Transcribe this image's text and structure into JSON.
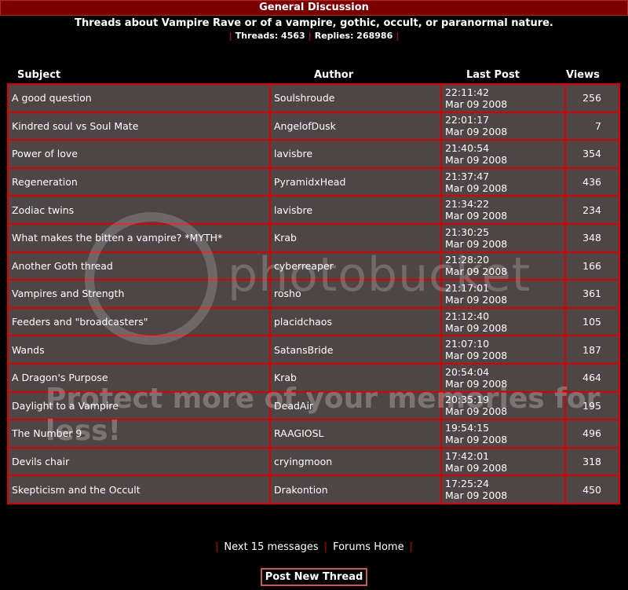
{
  "forum": {
    "title": "General Discussion",
    "description": "Threads about Vampire Rave or of a vampire, gothic, occult, or paranormal nature.",
    "threads": "Threads: 4563",
    "replies": "Replies: 268986"
  },
  "columns": {
    "subject": "Subject",
    "author": "Author",
    "last_post": "Last Post",
    "views": "Views"
  },
  "rows": [
    {
      "subject": "A good question",
      "author": "Soulshroude",
      "time": "22:11:42",
      "date": "Mar 09 2008",
      "views": "256"
    },
    {
      "subject": "Kindred soul vs Soul Mate",
      "author": "AngelofDusk",
      "time": "22:01:17",
      "date": "Mar 09 2008",
      "views": "7"
    },
    {
      "subject": "Power of love",
      "author": "lavisbre",
      "time": "21:40:54",
      "date": "Mar 09 2008",
      "views": "354"
    },
    {
      "subject": "Regeneration",
      "author": "PyramidxHead",
      "time": "21:37:47",
      "date": "Mar 09 2008",
      "views": "436"
    },
    {
      "subject": "Zodiac twins",
      "author": "lavisbre",
      "time": "21:34:22",
      "date": "Mar 09 2008",
      "views": "234"
    },
    {
      "subject": "What makes the bitten a vampire? *MYTH*",
      "author": "Krab",
      "time": "21:30:25",
      "date": "Mar 09 2008",
      "views": "348"
    },
    {
      "subject": "Another Goth thread",
      "author": "cyberreaper",
      "time": "21:28:20",
      "date": "Mar 09 2008",
      "views": "166"
    },
    {
      "subject": "Vampires and Strength",
      "author": "rosho",
      "time": "21:17:01",
      "date": "Mar 09 2008",
      "views": "361"
    },
    {
      "subject": "Feeders and \"broadcasters\"",
      "author": "placidchaos",
      "time": "21:12:40",
      "date": "Mar 09 2008",
      "views": "105"
    },
    {
      "subject": "Wands",
      "author": "SatansBride",
      "time": "21:07:10",
      "date": "Mar 09 2008",
      "views": "187"
    },
    {
      "subject": "A Dragon's Purpose",
      "author": "Krab",
      "time": "20:54:04",
      "date": "Mar 09 2008",
      "views": "464"
    },
    {
      "subject": "Daylight to a Vampire",
      "author": "DeadAir",
      "time": "20:35:19",
      "date": "Mar 09 2008",
      "views": "195"
    },
    {
      "subject": "The Number 9",
      "author": "RAAGIOSL",
      "time": "19:54:15",
      "date": "Mar 09 2008",
      "views": "496"
    },
    {
      "subject": "Devils chair",
      "author": "cryingmoon",
      "time": "17:42:01",
      "date": "Mar 09 2008",
      "views": "318"
    },
    {
      "subject": "Skepticism and the Occult",
      "author": "Drakontion",
      "time": "17:25:24",
      "date": "Mar 09 2008",
      "views": "450"
    }
  ],
  "nav": {
    "next": "Next 15 messages",
    "home": "Forums Home"
  },
  "post_button": "Post New Thread",
  "watermark": {
    "brand": "photobucket",
    "slogan": "Protect more of your memories for less!"
  }
}
